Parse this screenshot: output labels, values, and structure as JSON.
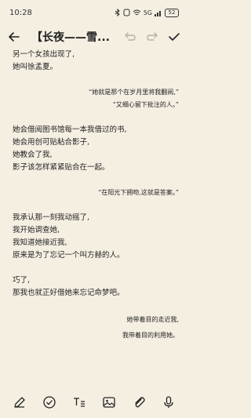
{
  "status": {
    "time": "10:28",
    "signal": "5G",
    "battery": "52"
  },
  "toolbar": {
    "title": "【长夜——雪..."
  },
  "lines": {
    "l1": "另一个女孩出现了,",
    "l2": "她叫徐孟夏。",
    "q1": "“她就是那个在岁月里将我翻阅,”",
    "q2": "“又细心留下批注的人。”",
    "l3": "她会借阅图书馆每一本我借过的书,",
    "l4": "她会用创可贴粘合影子,",
    "l5": "她教会了我,",
    "l6": "影子该怎样紧紧贴合在一起。",
    "q3": "“在阳光下拥吻,这就是答案。”",
    "l7": "我承认那一刻我动摇了,",
    "l8": "我开始调查她,",
    "l9": "我知道她接近我,",
    "l10": "原来是为了忘记一个叫方赫的人。",
    "l11": "巧了,",
    "l12": "那我也就正好借她来忘记命梦吧。",
    "r1": "她带着目的走近我,",
    "r2": "我带着目的利用她。"
  },
  "icons": {
    "back": "back-arrow-icon",
    "undo": "undo-icon",
    "redo": "redo-icon",
    "done": "check-icon",
    "pen": "pen-icon",
    "checklist": "checkbox-icon",
    "text_format": "text-format-icon",
    "image": "image-icon",
    "attachment": "paperclip-icon",
    "voice": "microphone-icon"
  },
  "colors": {
    "background": "#f5efe2",
    "text": "#222222",
    "disabled_icon": "#b8b2a6"
  }
}
